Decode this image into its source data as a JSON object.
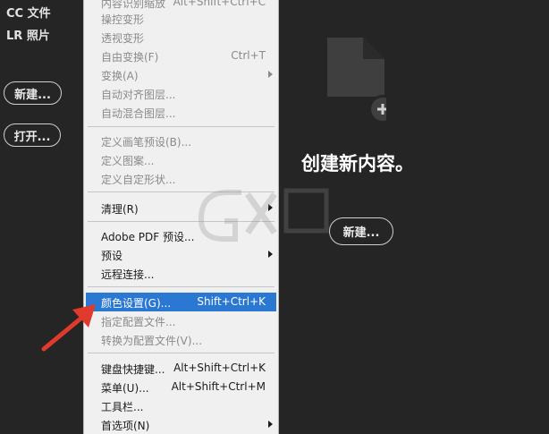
{
  "left_panel": {
    "cc_files": "CC 文件",
    "lr_photos": "LR 照片",
    "new_button": "新建...",
    "open_button": "打开..."
  },
  "menu": {
    "items": [
      {
        "label": "内容识别缩放",
        "shortcut": "Alt+Shift+Ctrl+C",
        "state": "disabled"
      },
      {
        "label": "操控变形",
        "shortcut": "",
        "state": "disabled"
      },
      {
        "label": "透视变形",
        "shortcut": "",
        "state": "disabled"
      },
      {
        "label": "自由变换(F)",
        "shortcut": "Ctrl+T",
        "state": "disabled"
      },
      {
        "label": "变换(A)",
        "shortcut": "",
        "state": "disabled",
        "submenu": true
      },
      {
        "label": "自动对齐图层...",
        "shortcut": "",
        "state": "disabled"
      },
      {
        "label": "自动混合图层...",
        "shortcut": "",
        "state": "disabled"
      },
      {
        "label": "定义画笔预设(B)...",
        "shortcut": "",
        "state": "disabled"
      },
      {
        "label": "定义图案...",
        "shortcut": "",
        "state": "disabled"
      },
      {
        "label": "定义自定形状...",
        "shortcut": "",
        "state": "disabled"
      },
      {
        "label": "清理(R)",
        "shortcut": "",
        "state": "enabled",
        "submenu": true
      },
      {
        "label": "Adobe PDF 预设...",
        "shortcut": "",
        "state": "enabled"
      },
      {
        "label": "预设",
        "shortcut": "",
        "state": "enabled",
        "submenu": true
      },
      {
        "label": "远程连接...",
        "shortcut": "",
        "state": "enabled"
      },
      {
        "label": "颜色设置(G)...",
        "shortcut": "Shift+Ctrl+K",
        "state": "highlighted"
      },
      {
        "label": "指定配置文件...",
        "shortcut": "",
        "state": "disabled"
      },
      {
        "label": "转换为配置文件(V)...",
        "shortcut": "",
        "state": "disabled"
      },
      {
        "label": "键盘快捷键...",
        "shortcut": "Alt+Shift+Ctrl+K",
        "state": "enabled"
      },
      {
        "label": "菜单(U)...",
        "shortcut": "Alt+Shift+Ctrl+M",
        "state": "enabled"
      },
      {
        "label": "工具栏...",
        "shortcut": "",
        "state": "enabled"
      },
      {
        "label": "首选项(N)",
        "shortcut": "",
        "state": "enabled",
        "submenu": true
      }
    ]
  },
  "main": {
    "title": "创建新内容。",
    "new_button": "新建..."
  },
  "colors": {
    "background": "#252525",
    "menu_background": "#f0f0f0",
    "highlight": "#2a78d1",
    "annotation_arrow": "#e03a2c"
  }
}
